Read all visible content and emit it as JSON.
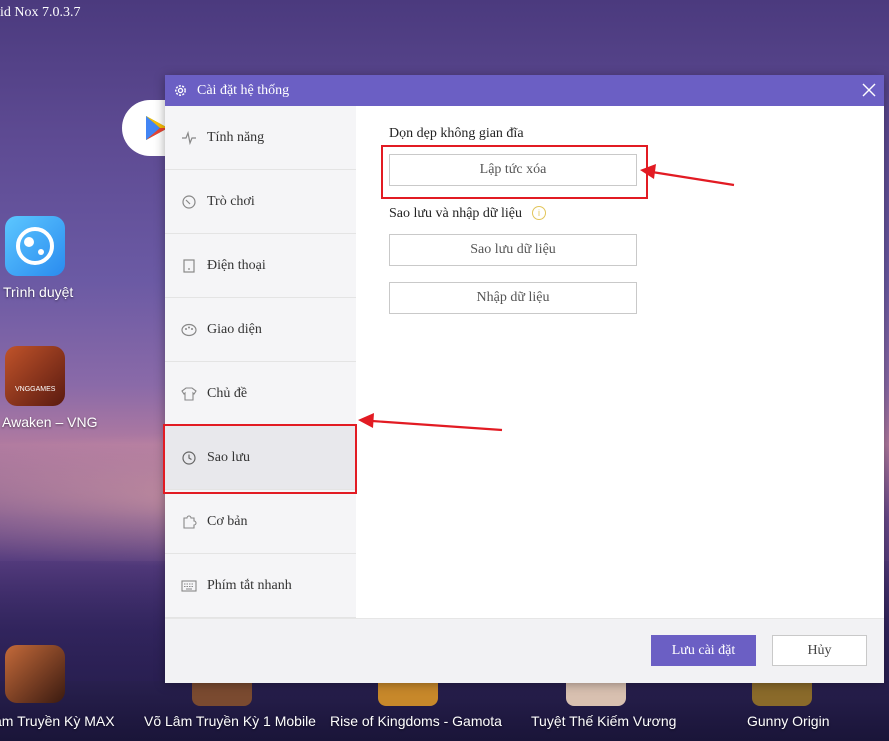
{
  "window": {
    "title": "id Nox 7.0.3.7"
  },
  "desktop": {
    "icons": [
      {
        "label": "Trình duyệt",
        "color": "#3fa8f5"
      },
      {
        "label": "Awaken – VNG",
        "color": "#8a2a1a"
      }
    ],
    "bottom_apps": [
      {
        "label": "âm Truyền Kỳ MAX"
      },
      {
        "label": "Võ Lâm Truyền Kỳ 1 Mobile"
      },
      {
        "label": "Rise of Kingdoms - Gamota"
      },
      {
        "label": "Tuyệt Thế Kiếm Vương"
      },
      {
        "label": "Gunny Origin"
      }
    ],
    "badge_text": "VNGGAMES"
  },
  "dialog": {
    "title": "Cài đặt hệ thống",
    "accent_color": "#6b5fc4",
    "sidebar": [
      {
        "label": "Tính năng",
        "icon": "pulse-icon",
        "active": false
      },
      {
        "label": "Trò chơi",
        "icon": "gamepad-icon",
        "active": false
      },
      {
        "label": "Điện thoại",
        "icon": "phone-icon",
        "active": false
      },
      {
        "label": "Giao diện",
        "icon": "palette-icon",
        "active": false
      },
      {
        "label": "Chủ đề",
        "icon": "shirt-icon",
        "active": false
      },
      {
        "label": "Sao lưu",
        "icon": "history-icon",
        "active": true
      },
      {
        "label": "Cơ bản",
        "icon": "puzzle-icon",
        "active": false
      },
      {
        "label": "Phím tắt nhanh",
        "icon": "keyboard-icon",
        "active": false
      }
    ],
    "content": {
      "disk_cleanup_title": "Dọn dẹp không gian đĩa",
      "clean_now_label": "Lập tức xóa",
      "backup_title": "Sao lưu và nhập dữ liệu",
      "info_glyph": "i",
      "backup_label": "Sao lưu dữ liệu",
      "import_label": "Nhập dữ liệu"
    },
    "footer": {
      "save_label": "Lưu cài đặt",
      "cancel_label": "Hủy"
    }
  },
  "annotation_color": "#e21b23"
}
